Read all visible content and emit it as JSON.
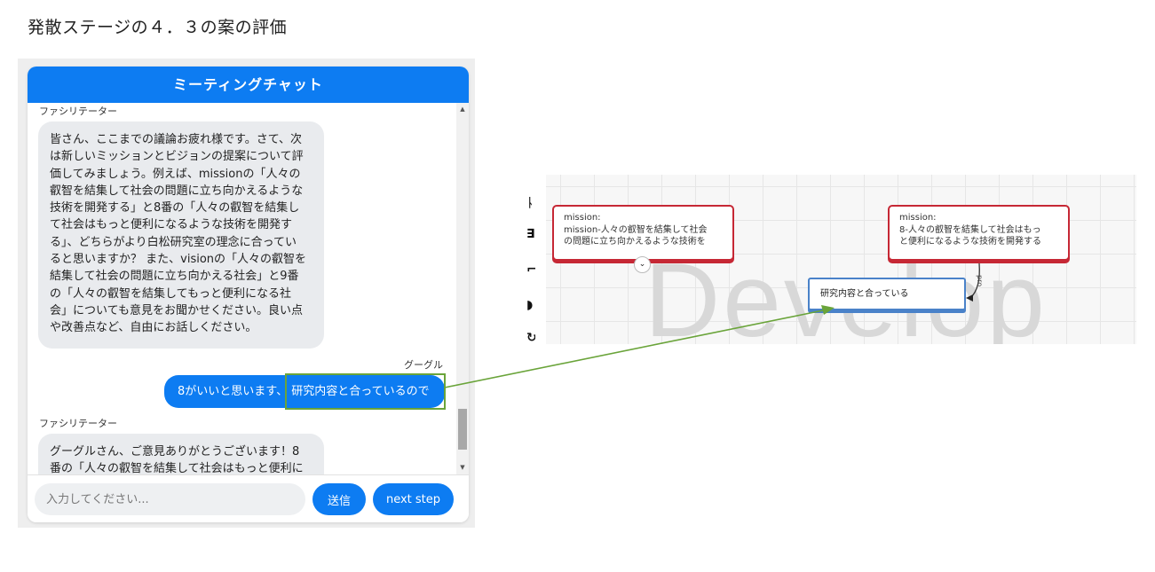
{
  "caption": "発散ステージの４．３の案の評価",
  "chat": {
    "title": "ミーティングチャット",
    "messages": [
      {
        "sender": "ファシリテーター",
        "lines": [
          "皆さん、ここまでの議論お疲れ様です。さて、次",
          "は新しいミッションとビジョンの提案について評",
          "価してみましょう。例えば、missionの「人々の",
          "叡智を結集して社会の問題に立ち向かえるような",
          "技術を開発する」と8番の「人々の叡智を結集し",
          "て社会はもっと便利になるような技術を開発す",
          "る」、どちらがより白松研究室の理念に合ってい",
          "ると思いますか？ また、visionの「人々の叡智を",
          "結集して社会の問題に立ち向かえる社会」と9番",
          "の「人々の叡智を結集してもっと便利になる社",
          "会」についても意見をお聞かせください。良い点",
          "や改善点など、自由にお話しください。"
        ]
      },
      {
        "sender": "グーグル",
        "text_plain": "8がいいと思います、",
        "text_highlight": "研究内容と合っているので"
      },
      {
        "sender": "ファシリテーター",
        "lines": [
          "グーグルさん、ご意見ありがとうございます！8",
          "番の「人々の叡智を結集して社会はもっと便利に"
        ]
      }
    ],
    "input": {
      "placeholder": "入力してください..."
    },
    "send_label": "送信",
    "next_label": "next step"
  },
  "mindmap": {
    "watermark": "Develop",
    "node_left": {
      "lines": [
        "mission:",
        "mission-人々の叡智を結集して社会",
        "の問題に立ち向かえるような技術を"
      ]
    },
    "node_right": {
      "lines": [
        "mission:",
        "8-人々の叡智を結集して社会はもっ",
        "と便利になるような技術を開発する"
      ]
    },
    "node_selected": {
      "text": "研究内容と合っている"
    },
    "edge_label": "pro",
    "toolbar_icons": [
      "cursor-icon",
      "layout-icon",
      "crop-icon",
      "tag-icon",
      "redo-icon"
    ]
  },
  "colors": {
    "accent": "#0d7cf2",
    "node_border": "#c62835",
    "selected_border": "#4a82c9",
    "annotation": "#6aa43a"
  }
}
